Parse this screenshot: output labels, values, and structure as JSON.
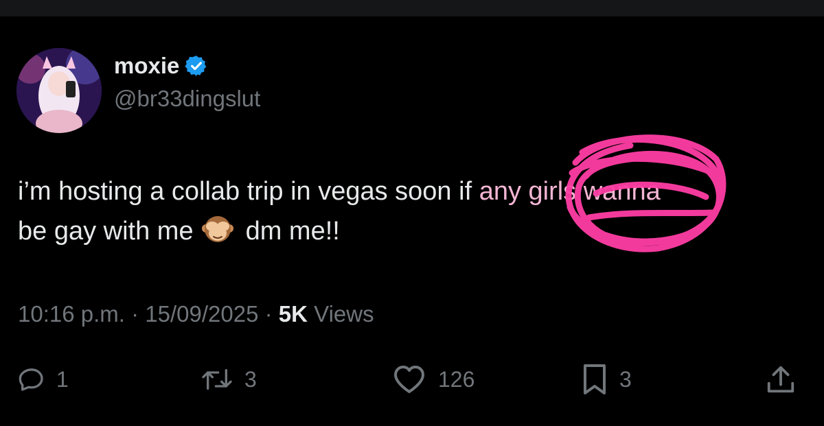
{
  "author": {
    "display_name": "moxie",
    "handle": "@br33dingslut",
    "verified_icon": "verified-badge-icon",
    "avatar_icon": "avatar"
  },
  "tweet": {
    "line1_before": "i’m hosting a collab trip in vegas soon if ",
    "line1_highlight": "any girls wanna",
    "line2_before": "be gay with me",
    "line2_emoji": "see-no-evil-monkey-emoji",
    "line2_after": "dm me!!"
  },
  "meta": {
    "time": "10:16 p.m.",
    "separator": "·",
    "date": "15/09/2025",
    "views_count": "5K",
    "views_label": "Views"
  },
  "actions": {
    "replies": "1",
    "retweets": "3",
    "likes": "126",
    "bookmarks": "3"
  },
  "colors": {
    "background": "#000000",
    "text": "#e7e9ea",
    "secondary_text": "#71767b",
    "verified_blue": "#1d9bf0",
    "scribble_pink": "#ff3ea5"
  }
}
